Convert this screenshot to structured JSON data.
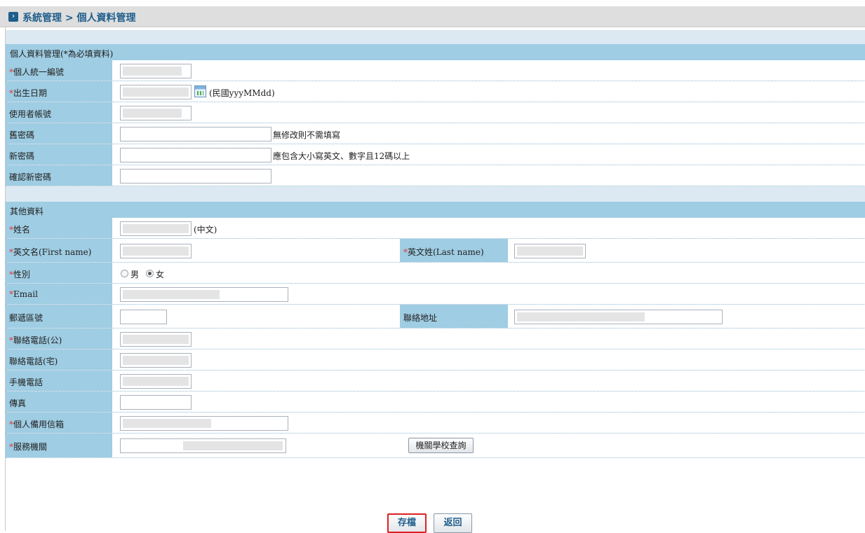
{
  "breadcrumb": "系統管理 > 個人資料管理",
  "section1": {
    "title": "個人資料管理(*為必填資料)",
    "fields": {
      "id_label": "個人統一編號",
      "birth_label": "出生日期",
      "birth_hint": "(民國yyyMMdd)",
      "account_label": "使用者帳號",
      "oldpw_label": "舊密碼",
      "oldpw_hint": "無修改則不需填寫",
      "newpw_label": "新密碼",
      "newpw_hint": "應包含大小寫英文、數字且12碼以上",
      "confirmpw_label": "確認新密碼"
    }
  },
  "section2": {
    "title": "其他資料",
    "fields": {
      "name_label": "姓名",
      "name_hint": "(中文)",
      "first_name_label": "英文名(First name)",
      "last_name_label": "英文姓(Last name)",
      "gender_label": "性別",
      "gender_male": "男",
      "gender_female": "女",
      "email_label": "Email",
      "zip_label": "郵遞區號",
      "address_label": "聯絡地址",
      "phone_office_label": "聯絡電話(公)",
      "phone_home_label": "聯絡電話(宅)",
      "mobile_label": "手機電話",
      "fax_label": "傳真",
      "backup_email_label": "個人備用信箱",
      "agency_label": "服務機關",
      "agency_search_button": "機關學校查詢"
    }
  },
  "required_mark": "*",
  "buttons": {
    "save": "存檔",
    "back": "返回"
  },
  "colors": {
    "label_bg": "#9fcde3",
    "gap_bg": "#dce9f3",
    "accent": "#1f5e8c",
    "required": "#e23b3b",
    "save_border": "#e02020"
  },
  "icons": {
    "breadcrumb": "arrow-right-icon",
    "calendar": "calendar-icon"
  }
}
